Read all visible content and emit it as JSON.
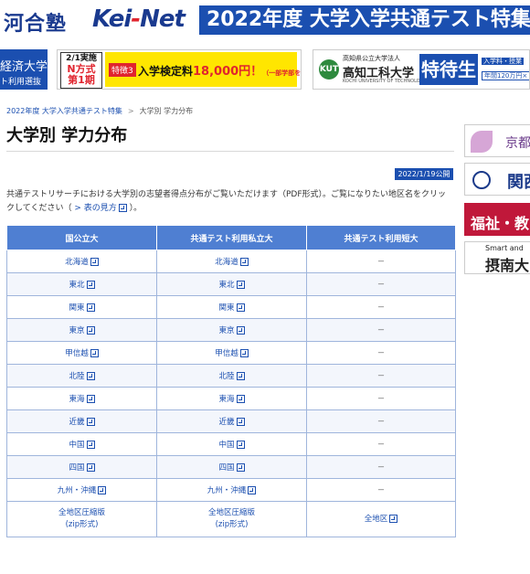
{
  "header": {
    "logo_kawai": "河合塾",
    "logo_keinet_a": "Kei",
    "logo_keinet_dash": "-",
    "logo_keinet_b": "Net",
    "top_title": "2022年度 大学入学共通テスト特集"
  },
  "banners": {
    "b1_line1": "経済大学",
    "b1_line2": "ト利用選抜",
    "b2_left_l1": "2/1実施",
    "b2_left_l2": "N方式",
    "b2_left_l3": "第1期",
    "b2_tag": "特徴3",
    "b2_text": "入学検定料",
    "b2_amount": "18,000円！",
    "b2_small": "（一部学部を除く）",
    "b3_logo": "KUT",
    "b3_sub": "高知県公立大学法人",
    "b3_name": "高知工科大学",
    "b3_en": "KOCHI UNIVERSITY OF TECHNOLOGY",
    "b3_tokutai": "特待生",
    "b3_side1": "入学料・授業",
    "b3_side2": "年間120万円×"
  },
  "breadcrumb": {
    "parent": "2022年度 大学入学共通テスト特集",
    "separator": ">",
    "current": "大学別 学力分布"
  },
  "page_title": "大学別 学力分布",
  "date_badge": "2022/1/19公開",
  "description": {
    "text": "共通テストリサーチにおける大学別の志望者得点分布がご覧いただけます（PDF形式）。ご覧になりたい地区名をクリックしてください（",
    "link_prefix": ">",
    "link": "表の見方",
    "suffix": "）。"
  },
  "table": {
    "headers": [
      "国公立大",
      "共通テスト利用私立大",
      "共通テスト利用短大"
    ],
    "rows": [
      [
        "北海道",
        "北海道",
        "－"
      ],
      [
        "東北",
        "東北",
        "－"
      ],
      [
        "関東",
        "関東",
        "－"
      ],
      [
        "東京",
        "東京",
        "－"
      ],
      [
        "甲信越",
        "甲信越",
        "－"
      ],
      [
        "北陸",
        "北陸",
        "－"
      ],
      [
        "東海",
        "東海",
        "－"
      ],
      [
        "近畿",
        "近畿",
        "－"
      ],
      [
        "中国",
        "中国",
        "－"
      ],
      [
        "四国",
        "四国",
        "－"
      ],
      [
        "九州・沖縄",
        "九州・沖縄",
        "－"
      ]
    ],
    "last_row": {
      "c1_l1": "全地区圧縮版",
      "c1_l2": "(zip形式)",
      "c2_l1": "全地区圧縮版",
      "c2_l2": "(zip形式)",
      "c3": "全地区"
    }
  },
  "sidebar": {
    "s1": "京都",
    "s2": "関西",
    "s3": "福祉・教",
    "s4_l1": "Smart and",
    "s4_l2": "摂南大"
  }
}
